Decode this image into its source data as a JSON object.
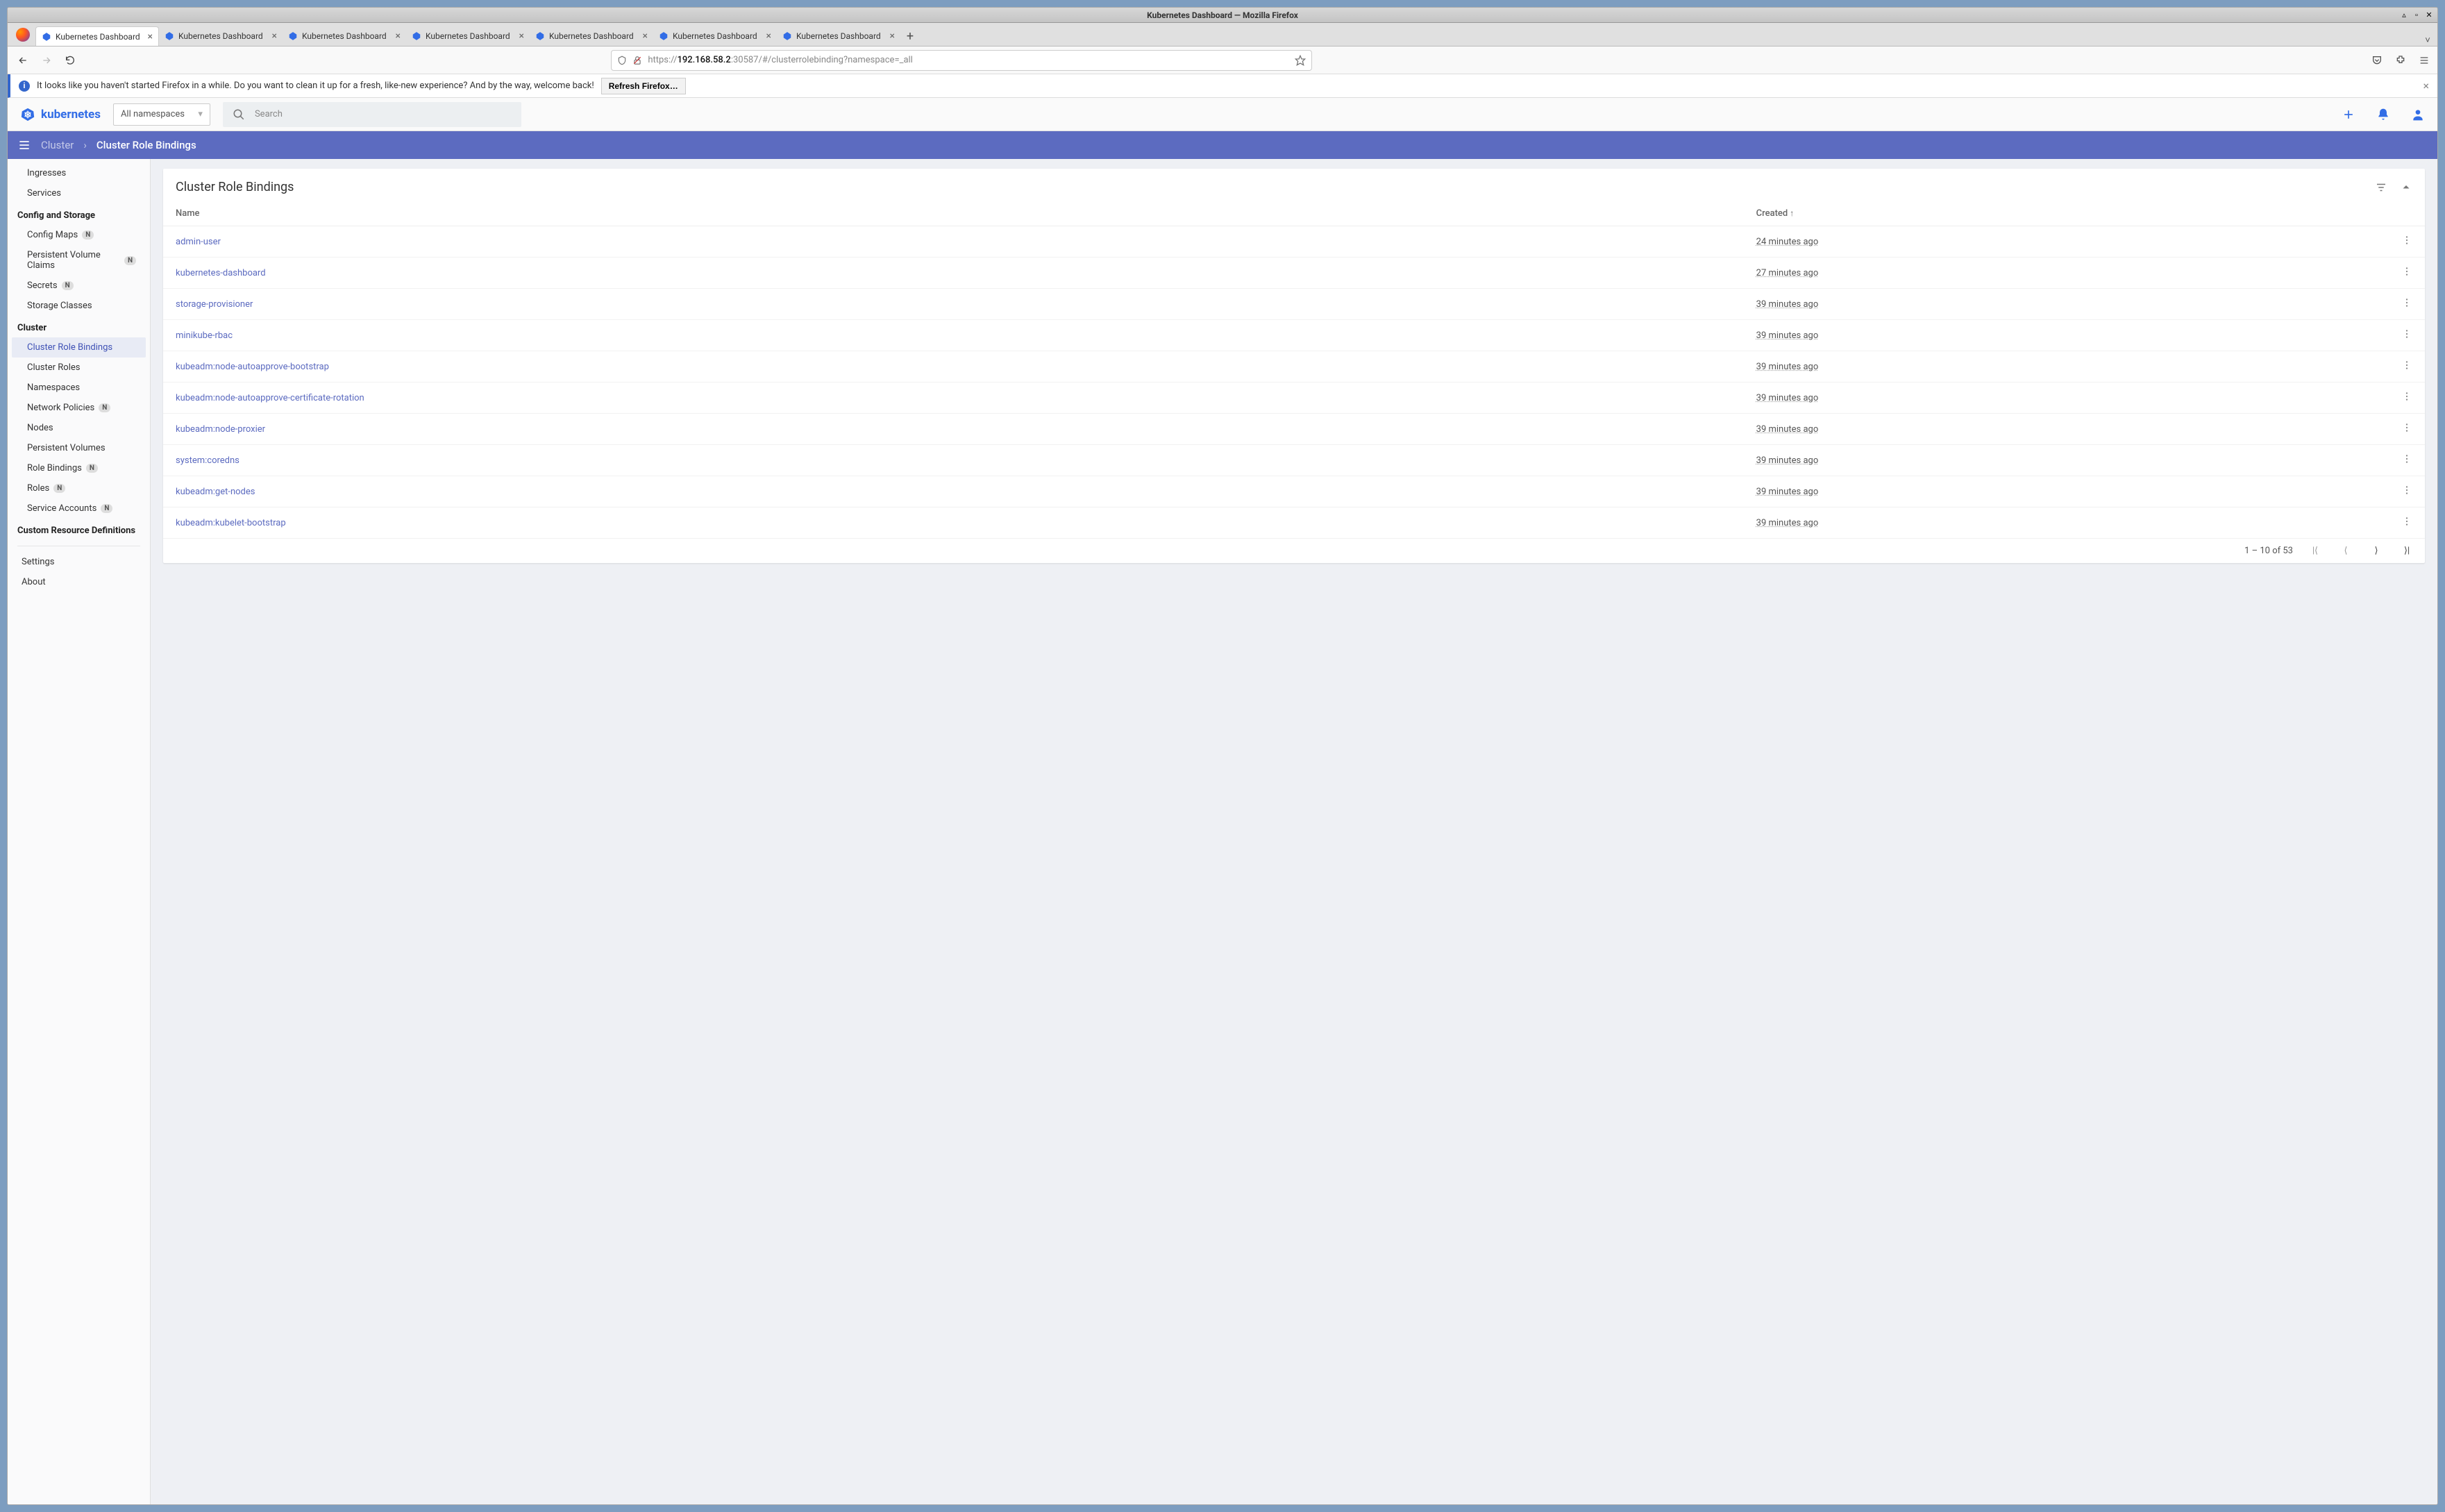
{
  "window": {
    "title": "Kubernetes Dashboard — Mozilla Firefox"
  },
  "tabs": {
    "label": "Kubernetes Dashboard"
  },
  "url": {
    "scheme": "https://",
    "host": "192.168.58.2",
    "path": ":30587/#/clusterrolebinding?namespace=_all"
  },
  "notification": {
    "text": "It looks like you haven't started Firefox in a while. Do you want to clean it up for a fresh, like-new experience? And by the way, welcome back!",
    "button": "Refresh Firefox…"
  },
  "app": {
    "brand": "kubernetes",
    "namespaceSelector": "All namespaces",
    "searchPlaceholder": "Search"
  },
  "breadcrumb": {
    "root": "Cluster",
    "leaf": "Cluster Role Bindings"
  },
  "sidebar": {
    "topItems": [
      {
        "label": "Ingresses",
        "badge": false
      },
      {
        "label": "Services",
        "badge": false
      }
    ],
    "configTitle": "Config and Storage",
    "configItems": [
      {
        "label": "Config Maps",
        "badge": true
      },
      {
        "label": "Persistent Volume Claims",
        "badge": true
      },
      {
        "label": "Secrets",
        "badge": true
      },
      {
        "label": "Storage Classes",
        "badge": false
      }
    ],
    "clusterTitle": "Cluster",
    "clusterItems": [
      {
        "label": "Cluster Role Bindings",
        "badge": false,
        "selected": true
      },
      {
        "label": "Cluster Roles",
        "badge": false
      },
      {
        "label": "Namespaces",
        "badge": false
      },
      {
        "label": "Network Policies",
        "badge": true
      },
      {
        "label": "Nodes",
        "badge": false
      },
      {
        "label": "Persistent Volumes",
        "badge": false
      },
      {
        "label": "Role Bindings",
        "badge": true
      },
      {
        "label": "Roles",
        "badge": true
      },
      {
        "label": "Service Accounts",
        "badge": true
      }
    ],
    "crdTitle": "Custom Resource Definitions",
    "settings": "Settings",
    "about": "About"
  },
  "table": {
    "title": "Cluster Role Bindings",
    "colName": "Name",
    "colCreated": "Created",
    "rows": [
      {
        "name": "admin-user",
        "created": "24 minutes ago"
      },
      {
        "name": "kubernetes-dashboard",
        "created": "27 minutes ago"
      },
      {
        "name": "storage-provisioner",
        "created": "39 minutes ago"
      },
      {
        "name": "minikube-rbac",
        "created": "39 minutes ago"
      },
      {
        "name": "kubeadm:node-autoapprove-bootstrap",
        "created": "39 minutes ago"
      },
      {
        "name": "kubeadm:node-autoapprove-certificate-rotation",
        "created": "39 minutes ago"
      },
      {
        "name": "kubeadm:node-proxier",
        "created": "39 minutes ago"
      },
      {
        "name": "system:coredns",
        "created": "39 minutes ago"
      },
      {
        "name": "kubeadm:get-nodes",
        "created": "39 minutes ago"
      },
      {
        "name": "kubeadm:kubelet-bootstrap",
        "created": "39 minutes ago"
      }
    ],
    "pagination": "1 – 10 of 53"
  }
}
